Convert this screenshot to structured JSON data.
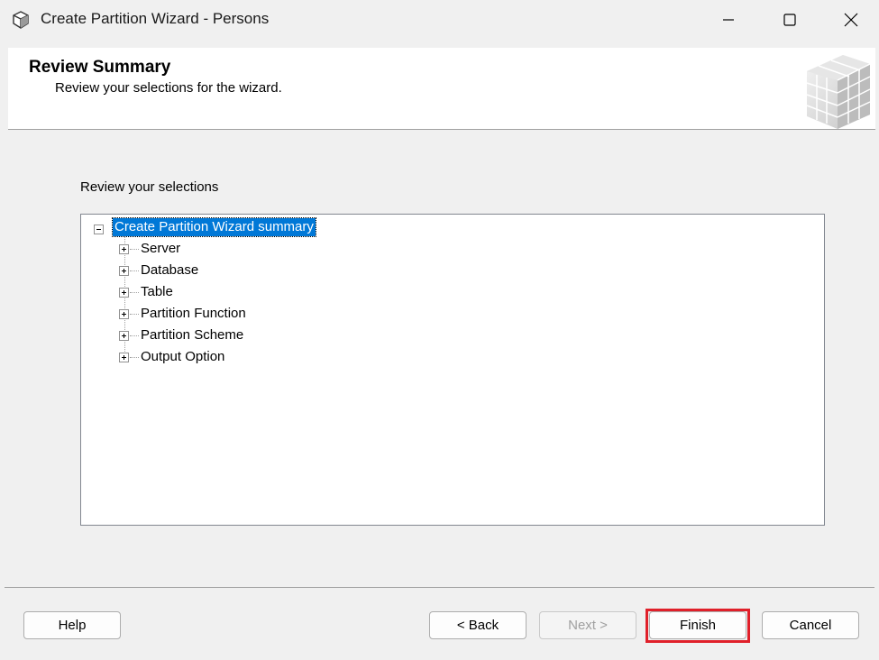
{
  "window": {
    "title": "Create Partition Wizard - Persons",
    "icons": {
      "app": "cube-icon",
      "minimize": "minimize-icon",
      "maximize": "maximize-icon",
      "close": "close-icon"
    }
  },
  "header": {
    "title": "Review Summary",
    "subtitle": "Review your selections for the wizard.",
    "graphic": "cube-grid-icon"
  },
  "main": {
    "review_label": "Review your selections",
    "tree": {
      "root": "Create Partition Wizard summary",
      "root_selected": true,
      "items": [
        {
          "label": "Server"
        },
        {
          "label": "Database"
        },
        {
          "label": "Table"
        },
        {
          "label": "Partition Function"
        },
        {
          "label": "Partition Scheme"
        },
        {
          "label": "Output Option"
        }
      ]
    }
  },
  "buttons": {
    "help": "Help",
    "back": "< Back",
    "next": "Next >",
    "finish": "Finish",
    "cancel": "Cancel"
  },
  "colors": {
    "selection": "#0078d7",
    "highlight": "#e0202a",
    "disabled_text": "#a0a0a0"
  }
}
